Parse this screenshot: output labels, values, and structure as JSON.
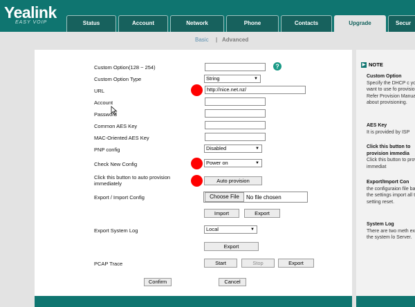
{
  "brand": {
    "logo": "Yealink",
    "tagline": "EASY VOIP"
  },
  "tabs": [
    {
      "label": "Status"
    },
    {
      "label": "Account"
    },
    {
      "label": "Network"
    },
    {
      "label": "Phone"
    },
    {
      "label": "Contacts"
    },
    {
      "label": "Upgrade"
    },
    {
      "label": "Secur"
    }
  ],
  "subnav": {
    "basic": "Basic",
    "sep": "|",
    "advanced": "Advanced"
  },
  "form": {
    "custom_option_label": "Custom Option(128 ~ 254)",
    "custom_option_value": "",
    "custom_option_type_label": "Custom Option Type",
    "custom_option_type_value": "String",
    "url_label": "URL",
    "url_value": "http://nice.net.nz/",
    "account_label": "Account",
    "account_value": "",
    "password_label": "Password",
    "password_value": "",
    "aes_label": "Common AES Key",
    "aes_value": "",
    "mac_aes_label": "MAC-Oriented AES Key",
    "mac_aes_value": "",
    "pnp_label": "PNP config",
    "pnp_value": "Disabled",
    "check_new_label": "Check New Config",
    "check_new_value": "Power on",
    "auto_prov_label": "Click this button to auto provision immediately",
    "auto_prov_button": "Auto provision",
    "export_import_label": "Export / Import Config",
    "choose_file_button": "Choose File",
    "no_file_text": "No file chosen",
    "import_button": "Import",
    "export_button": "Export",
    "export_log_label": "Export System Log",
    "export_log_value": "Local",
    "export_log_button": "Export",
    "pcap_label": "PCAP Trace",
    "pcap_start": "Start",
    "pcap_stop": "Stop",
    "pcap_export": "Export",
    "confirm_button": "Confirm",
    "cancel_button": "Cancel",
    "help_symbol": "?"
  },
  "note": {
    "header": "NOTE",
    "sections": [
      {
        "title": "Custom Option",
        "body": "Specify the DHCP c you want to use fo provisioning. Refer Provision Manual f about provisioning."
      },
      {
        "title": "AES Key",
        "body": "It is provided by ISP"
      },
      {
        "title": "Click this button to provision immedia",
        "body": "Click this button to provision immediat"
      },
      {
        "title": "Export/Import Con",
        "body": "the configuraion file backup the settings import all the setting reset."
      },
      {
        "title": "System Log",
        "body": "There are two meth export the system lo Server."
      }
    ]
  },
  "colors": {
    "brand": "#0f7570",
    "marker": "#ff0000",
    "help": "#1a9a86"
  }
}
